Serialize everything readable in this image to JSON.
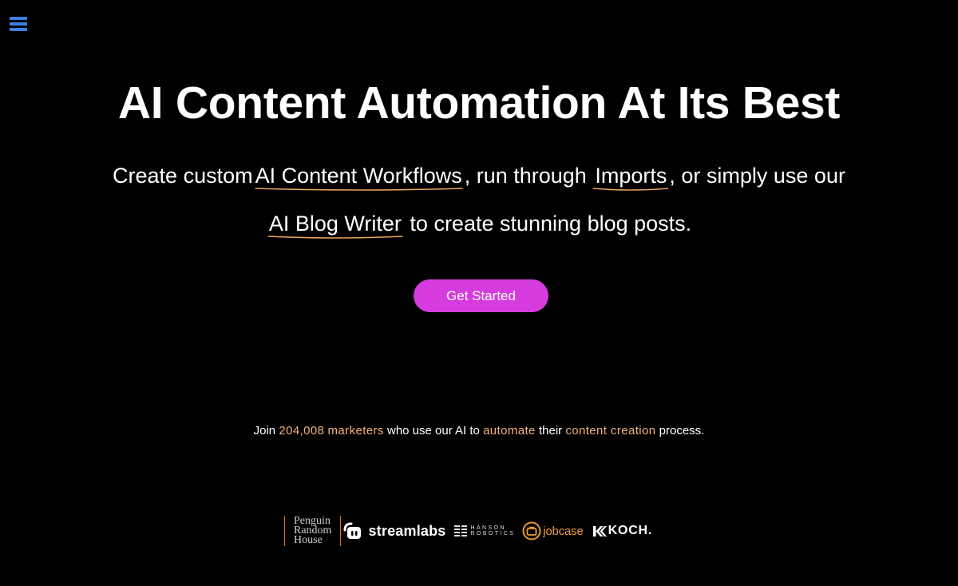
{
  "nav": {
    "menu_icon": "hamburger-menu-icon",
    "menu_color": "#3c7fe0"
  },
  "hero": {
    "title": "AI Content Automation At Its Best",
    "subtitle_part1": "Create custom",
    "link_workflows": "AI Content Workflows",
    "subtitle_part2": ", run through",
    "link_imports": "Imports",
    "subtitle_part3": ", or simply use our",
    "link_blog_writer": "AI Blog Writer",
    "subtitle_part4": "to create stunning blog posts.",
    "underline_color": "#e8a45c"
  },
  "cta": {
    "label": "Get Started",
    "color": "#d63cdd"
  },
  "social_proof": {
    "prefix": "Join",
    "count": "204,008",
    "marketers": "marketers",
    "middle1": "who use our AI to",
    "automate": "automate",
    "middle2": "their",
    "content_creation": "content creation",
    "suffix": "process.",
    "accent_color": "#f2b27a"
  },
  "logos": {
    "penguin": {
      "line1": "Penguin",
      "line2": "Random",
      "line3": "House"
    },
    "streamlabs": {
      "icon": "streamlabs-icon",
      "name": "streamlabs"
    },
    "hanson": {
      "icon": "hanson-robotics-icon",
      "line1": "HANSON",
      "line2": "ROBOTICS"
    },
    "jobcase": {
      "icon": "jobcase-icon",
      "name": "jobcase"
    },
    "koch": {
      "icon": "koch-icon",
      "name": "KOCH."
    }
  }
}
